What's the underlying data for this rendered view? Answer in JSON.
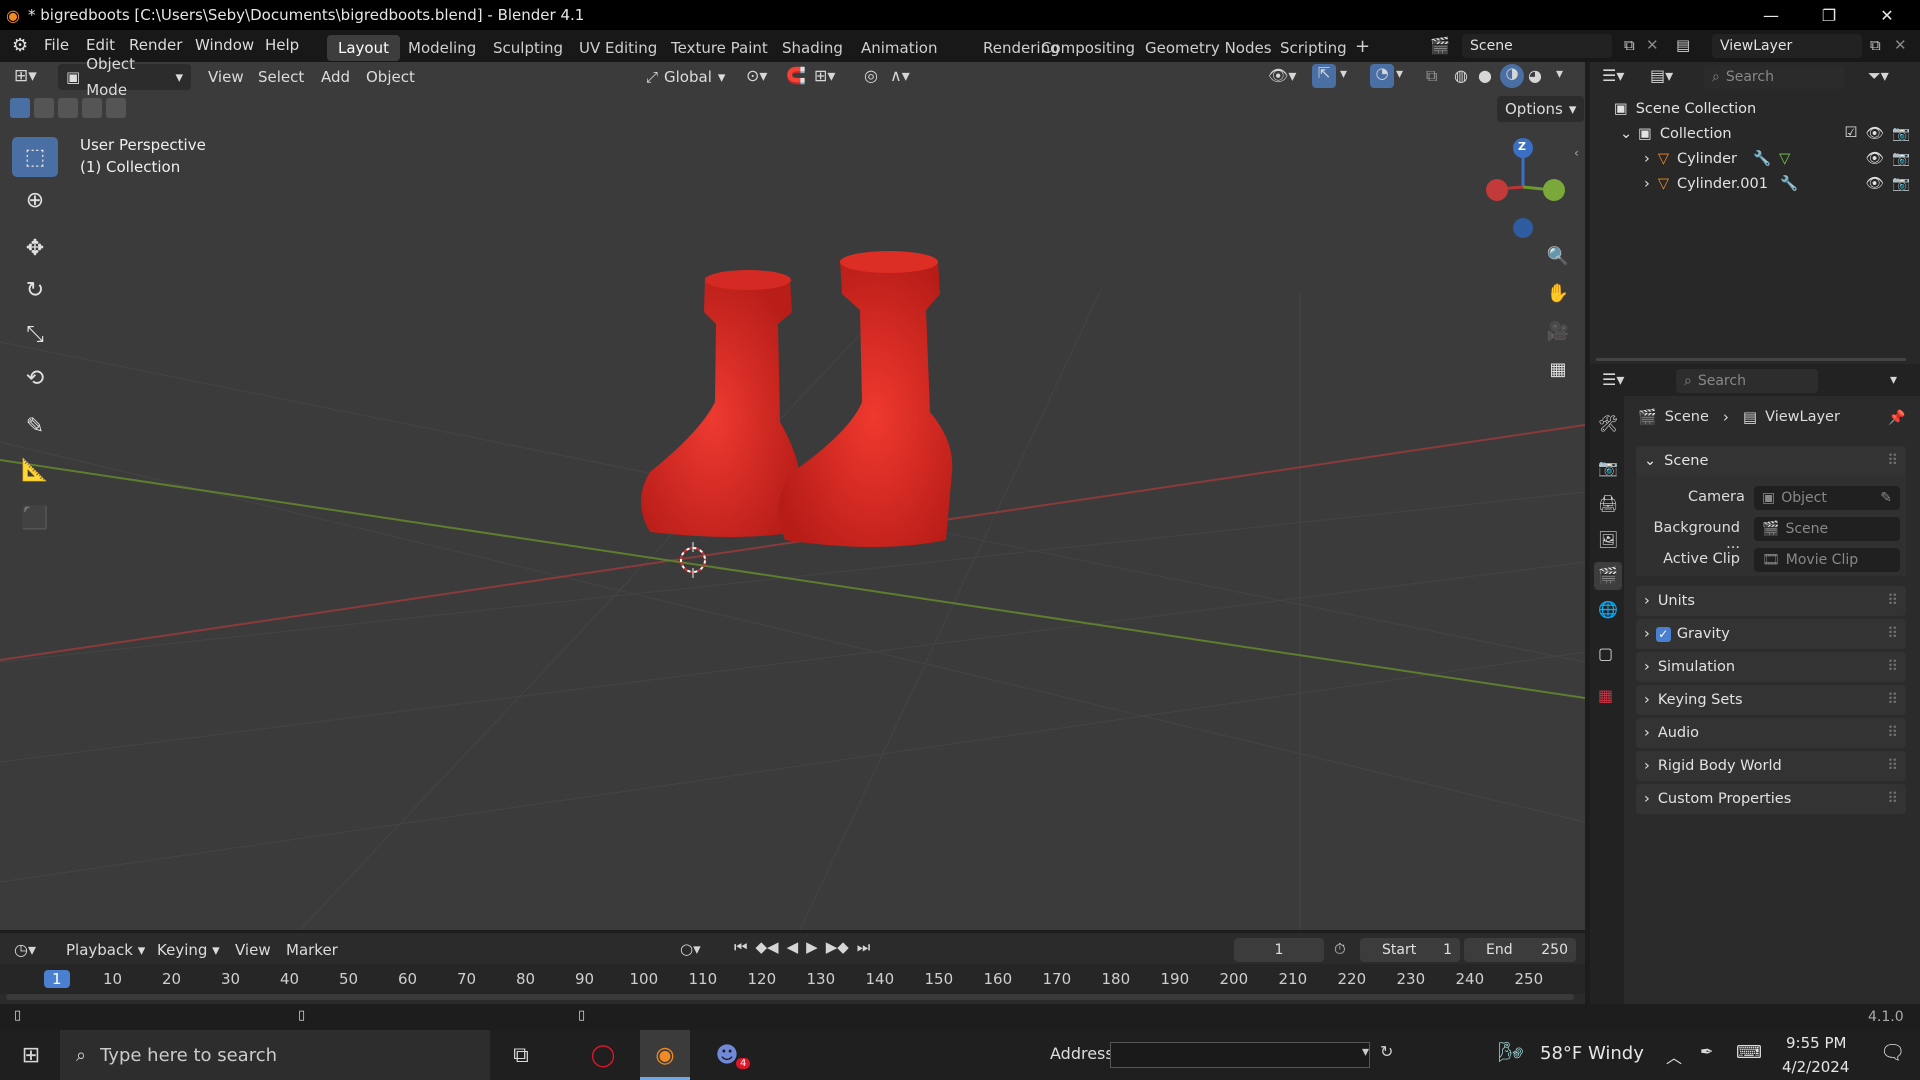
{
  "window": {
    "title": "* bigredboots [C:\\Users\\Seby\\Documents\\bigredboots.blend] - Blender 4.1",
    "minimize": "—",
    "maximize": "❐",
    "close": "✕"
  },
  "menu": [
    "File",
    "Edit",
    "Render",
    "Window",
    "Help"
  ],
  "workspaces": [
    "Layout",
    "Modeling",
    "Sculpting",
    "UV Editing",
    "Texture Paint",
    "Shading",
    "Animation",
    "Rendering",
    "Compositing",
    "Geometry Nodes",
    "Scripting"
  ],
  "active_workspace": "Layout",
  "scene_selector": "Scene",
  "viewlayer_selector": "ViewLayer",
  "viewport": {
    "mode": "Object Mode",
    "menus": [
      "View",
      "Select",
      "Add",
      "Object"
    ],
    "transform_orientation": "Global",
    "options": "Options",
    "info_line1": "User Perspective",
    "info_line2": "(1) Collection",
    "gizmo_z": "Z",
    "background_color": "#3b3b3b",
    "boot_color": "#e8302a"
  },
  "outliner": {
    "search_placeholder": "Search",
    "scene_collection": "Scene Collection",
    "collection": "Collection",
    "objects": [
      "Cylinder",
      "Cylinder.001"
    ]
  },
  "properties": {
    "search_placeholder": "Search",
    "breadcrumb_scene": "Scene",
    "breadcrumb_viewlayer": "ViewLayer",
    "scene_panel": "Scene",
    "camera_label": "Camera",
    "camera_value": "Object",
    "background_label": "Background ...",
    "background_value": "Scene",
    "active_clip_label": "Active Clip",
    "active_clip_value": "Movie Clip",
    "panels": [
      "Units",
      "Gravity",
      "Simulation",
      "Keying Sets",
      "Audio",
      "Rigid Body World",
      "Custom Properties"
    ],
    "gravity_checked": true
  },
  "timeline": {
    "menus": [
      "Playback",
      "Keying",
      "View",
      "Marker"
    ],
    "current_frame": "1",
    "start_label": "Start",
    "start_value": "1",
    "end_label": "End",
    "end_value": "250",
    "ticks": [
      "1",
      "10",
      "20",
      "30",
      "40",
      "50",
      "60",
      "70",
      "80",
      "90",
      "100",
      "110",
      "120",
      "130",
      "140",
      "150",
      "160",
      "170",
      "180",
      "190",
      "200",
      "210",
      "220",
      "230",
      "240",
      "250"
    ]
  },
  "statusbar": {
    "version": "4.1.0"
  },
  "taskbar": {
    "search_placeholder": "Type here to search",
    "address_label": "Address",
    "weather": "58°F  Windy",
    "time": "9:55 PM",
    "date": "4/2/2024",
    "discord_badge": "4"
  }
}
